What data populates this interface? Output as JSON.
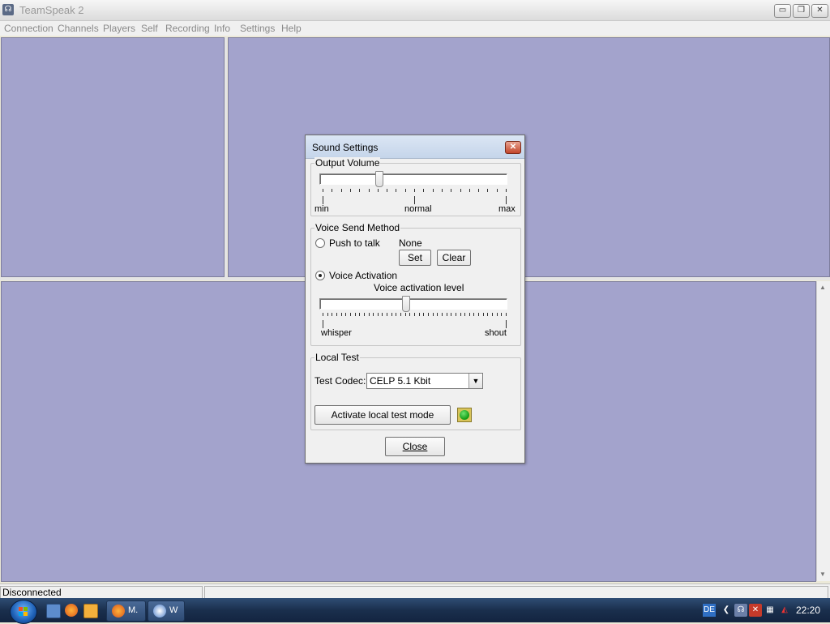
{
  "window": {
    "title": "TeamSpeak 2",
    "buttons": {
      "minimize": "▭",
      "restore": "❐",
      "close": "✕"
    }
  },
  "menu": [
    "Connection",
    "Channels",
    "Players",
    "Self",
    "Recording",
    "Info",
    "Settings",
    "Help"
  ],
  "status": {
    "text": "Disconnected"
  },
  "colors": {
    "panel": "#a3a3cc",
    "dialog": "#f0f0f0"
  },
  "dialog": {
    "title": "Sound Settings",
    "output_volume": {
      "label": "Output Volume",
      "value_fraction": 0.31,
      "min_label": "min",
      "mid_label": "normal",
      "max_label": "max"
    },
    "voice_send": {
      "label": "Voice Send Method",
      "push_to_talk": {
        "label": "Push to talk",
        "selected": false
      },
      "hotkey": "None",
      "set_label": "Set",
      "clear_label": "Clear",
      "voice_activation": {
        "label": "Voice Activation",
        "selected": true
      },
      "level_label": "Voice activation level",
      "level_fraction": 0.46,
      "min_label": "whisper",
      "max_label": "shout"
    },
    "local_test": {
      "label": "Local Test",
      "codec_label": "Test Codec:",
      "codec_value": "CELP 5.1 Kbit",
      "activate_label": "Activate local test mode"
    },
    "close_label": "Close"
  },
  "taskbar": {
    "tasks": [
      {
        "label": "M.",
        "icon": "firefox-icon"
      },
      {
        "label": "W",
        "icon": "media-icon"
      }
    ],
    "tray": {
      "lang": "DE",
      "clock": "22:20"
    }
  }
}
